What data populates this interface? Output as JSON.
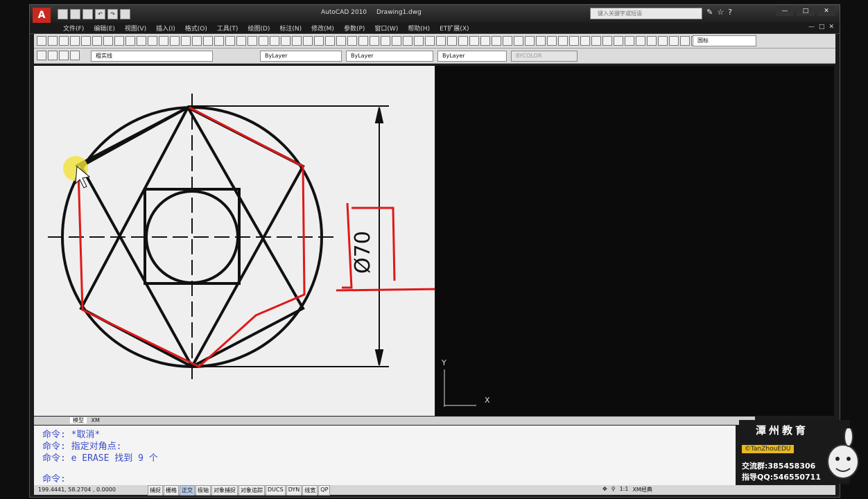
{
  "app": {
    "title": "AutoCAD 2010",
    "document": "Drawing1.dwg",
    "search_placeholder": "键入关键字或短语",
    "window_controls": [
      "—",
      "□",
      "✕"
    ],
    "doc_controls": [
      "—",
      "□",
      "✕"
    ]
  },
  "menu": [
    "文件(F)",
    "编辑(E)",
    "视图(V)",
    "插入(I)",
    "格式(O)",
    "工具(T)",
    "绘图(D)",
    "标注(N)",
    "修改(M)",
    "参数(P)",
    "窗口(W)",
    "帮助(H)",
    "ET扩展(X)"
  ],
  "toolbar": {
    "layer_name": "粗实线",
    "color": "ByLayer",
    "linetype": "ByLayer",
    "lineweight": "ByLayer",
    "plotstyle": "BYCOLOR",
    "dimstyle": "国标"
  },
  "drawing": {
    "dimension_text": "Ø70",
    "ucs_y": "Y",
    "ucs_x": "X"
  },
  "layout_tabs": [
    "模型",
    "XM"
  ],
  "command": {
    "lines": [
      "命令: *取消*",
      "命令: 指定对角点:",
      "命令: e ERASE 找到 9 个"
    ],
    "prompt": "命令:"
  },
  "status": {
    "coords": "199.4441, 58.2704 , 0.0000",
    "toggles": [
      "捕捉",
      "栅格",
      "正交",
      "极轴",
      "对象捕捉",
      "对象追踪",
      "DUCS",
      "DYN",
      "线宽",
      "QP"
    ],
    "toggles_on": [
      "正交"
    ],
    "scale": "1:1",
    "workspace": "XM经典"
  },
  "brand": {
    "name": "潭州教育",
    "copyright": "©TanZhouEDU",
    "group": "交流群:385458306",
    "qq": "指导QQ:546550711"
  },
  "colors": {
    "accent_red": "#e01818",
    "command_text": "#3a4cc8",
    "logo_red": "#c8281e"
  }
}
